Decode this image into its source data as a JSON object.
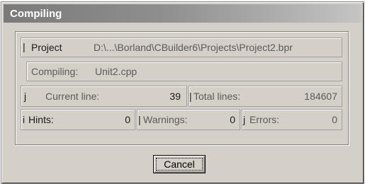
{
  "window": {
    "title": "Compiling"
  },
  "project": {
    "label": "Project",
    "value": "D:\\...\\Borland\\CBuilder6\\Projects\\Project2.bpr"
  },
  "status": {
    "label": "Compiling:",
    "value": "Unit2.cpp"
  },
  "current_line": {
    "label": "Current line:",
    "value": "39"
  },
  "total_lines": {
    "label": "Total lines:",
    "value": "184607"
  },
  "hints": {
    "label": "Hints:",
    "value": "0"
  },
  "warnings": {
    "label": "Warnings:",
    "value": "0"
  },
  "errors": {
    "label": "Errors:",
    "value": "0"
  },
  "buttons": {
    "cancel": "Cancel"
  }
}
